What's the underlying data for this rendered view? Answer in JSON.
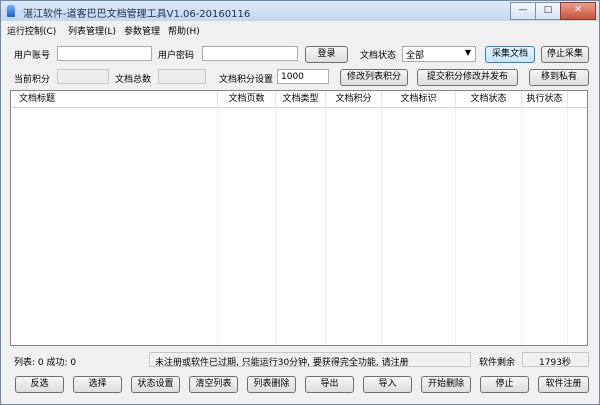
{
  "window": {
    "title": "湛江软件-道客巴巴文档管理工具V1.06-20160116",
    "controls": {
      "minimize": "—",
      "maximize": "□",
      "close": "✕"
    }
  },
  "menu": [
    "运行控制(C)",
    "列表管理(L)",
    "参数管理",
    "帮助(H)"
  ],
  "login": {
    "user_label": "用户账号",
    "user_value": "",
    "pass_label": "用户密码",
    "pass_value": "",
    "login_button": "登录",
    "status_label": "文档状态",
    "status_value": "全部",
    "collect_button": "采集文档",
    "stop_button": "停止采集"
  },
  "points": {
    "current_label": "当前积分",
    "current_value": "",
    "total_label": "文档总数",
    "total_value": "",
    "setting_label": "文档积分设置",
    "setting_value": "1000",
    "modify_button": "修改列表积分",
    "submit_button": "提交积分修改并发布",
    "move_button": "移到私有"
  },
  "table": {
    "columns": [
      "文档标题",
      "文档页数",
      "文档类型",
      "文档积分",
      "文档标识",
      "文档状态",
      "执行状态"
    ],
    "rows": []
  },
  "status": {
    "counts": "列表: 0 成功: 0",
    "message": "未注册或软件已过期, 只能运行30分钟, 要获得完全功能, 请注册",
    "remaining_label": "软件剩余",
    "remaining_value": "1793秒"
  },
  "bottom_buttons": [
    "反选",
    "选择",
    "状态设置",
    "清空列表",
    "列表删除",
    "导出",
    "导入",
    "开始删除",
    "停止",
    "软件注册"
  ]
}
